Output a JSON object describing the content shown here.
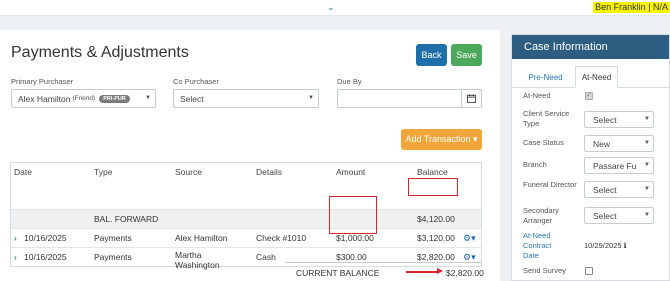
{
  "topbar": {
    "chevron": "⌄",
    "user": "Ben Franklin | N/A"
  },
  "page": {
    "title": "Payments & Adjustments",
    "back": "Back",
    "save": "Save"
  },
  "form": {
    "primary_label": "Primary Purchaser",
    "primary_value": "Alex Hamilton",
    "primary_relation": "(Friend)",
    "primary_badge": "PRI-PUR",
    "co_label": "Co Purchaser",
    "co_value": "Select",
    "due_label": "Due By",
    "due_value": ""
  },
  "add_transaction": "Add Transaction ▾",
  "table": {
    "headers": [
      "Date",
      "Type",
      "Source",
      "Details",
      "Amount",
      "Balance"
    ],
    "balance_forward": {
      "type": "BAL. FORWARD",
      "balance": "$4,120.00"
    },
    "rows": [
      {
        "date": "10/16/2025",
        "type": "Payments",
        "source": "Alex Hamilton",
        "source2": "",
        "details": "Check #1010",
        "amount": "$1,000.00",
        "balance": "$3,120.00"
      },
      {
        "date": "10/16/2025",
        "type": "Payments",
        "source": "Martha",
        "source2": "Washington",
        "details": "Cash",
        "amount": "$300.00",
        "balance": "$2,820.00"
      }
    ]
  },
  "current_balance": {
    "label": "CURRENT BALANCE",
    "value": "$2,820.00"
  },
  "sidebar": {
    "title": "Case Information",
    "tabs": [
      "Pre-Need",
      "At-Need"
    ],
    "at_need_label": "At-Need",
    "client_service_type_label": "Client Service Type",
    "client_service_type_value": "Select",
    "case_status_label": "Case Status",
    "case_status_value": "New",
    "branch_label": "Branch",
    "branch_value": "Passare Fu",
    "funeral_director_label": "Funeral Director",
    "funeral_director_value": "Select",
    "secondary_arranger_label": "Secondary Arranger",
    "secondary_arranger_value": "Select",
    "contract_date_label": "At-Need Contract Date",
    "contract_date_value": "10/29/2025",
    "send_survey_label": "Send Survey"
  },
  "colors": {
    "header": "#2d5e82",
    "save": "#4ca85a",
    "back": "#1f6fa8",
    "add": "#f0a63a",
    "highlight": "#d8232a"
  }
}
